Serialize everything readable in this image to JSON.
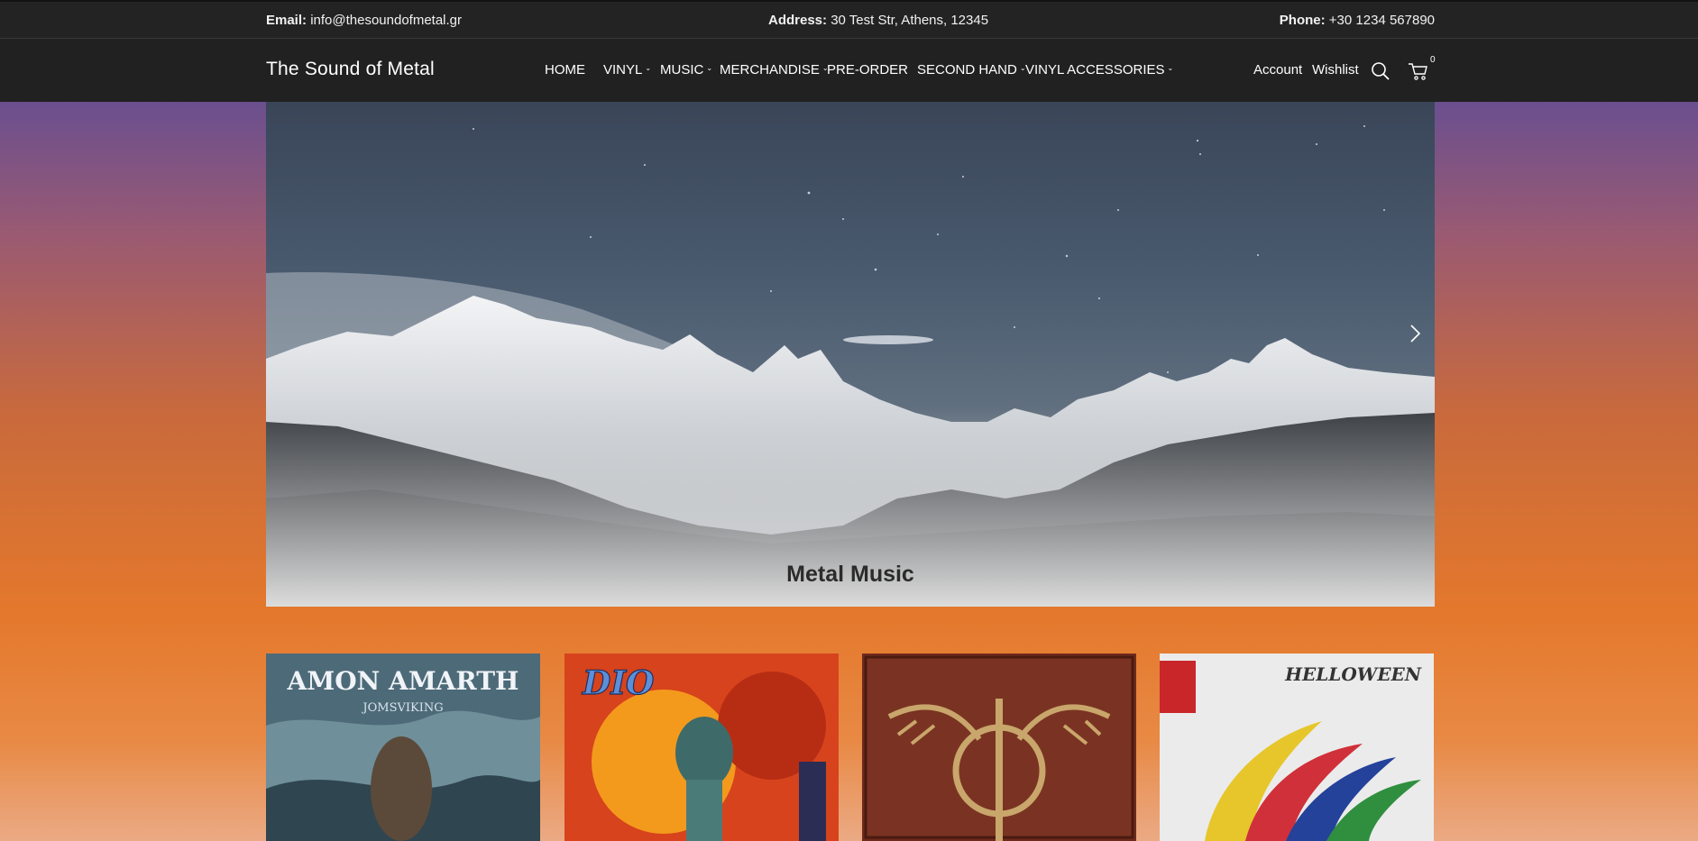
{
  "topbar": {
    "email_label": "Email:",
    "email_value": "info@thesoundofmetal.gr",
    "address_label": "Address:",
    "address_value": "30 Test Str, Athens, 12345",
    "phone_label": "Phone:",
    "phone_value": "+30 1234 567890"
  },
  "header": {
    "logo": "The Sound of Metal",
    "menu": [
      {
        "label": "HOME",
        "has_dropdown": false
      },
      {
        "label": "VINYL",
        "has_dropdown": true
      },
      {
        "label": "MUSIC",
        "has_dropdown": true
      },
      {
        "label": "MERCHANDISE",
        "has_dropdown": true
      },
      {
        "label": "PRE-ORDER",
        "has_dropdown": false
      },
      {
        "label": "SECOND HAND",
        "has_dropdown": true
      },
      {
        "label": "VINYL ACCESSORIES",
        "has_dropdown": true
      }
    ],
    "account_label": "Account",
    "wishlist_label": "Wishlist",
    "cart_count": "0",
    "icons": [
      "search-icon",
      "cart-icon",
      "chevron-down-icon"
    ]
  },
  "hero": {
    "title": "Metal Music",
    "next_icon": "chevron-right-icon"
  },
  "products": [
    {
      "cover_text": "AMON AMARTH",
      "cover_subtitle": "JOMSVIKING"
    },
    {
      "cover_text": "DIO"
    },
    {
      "cover_text": ""
    },
    {
      "cover_text": "HELLOWEEN"
    }
  ],
  "colors": {
    "topbar_bg": "#232323",
    "nav_bg": "#212121",
    "gradient_top": "#6a4f8f",
    "gradient_mid": "#e4782c"
  }
}
